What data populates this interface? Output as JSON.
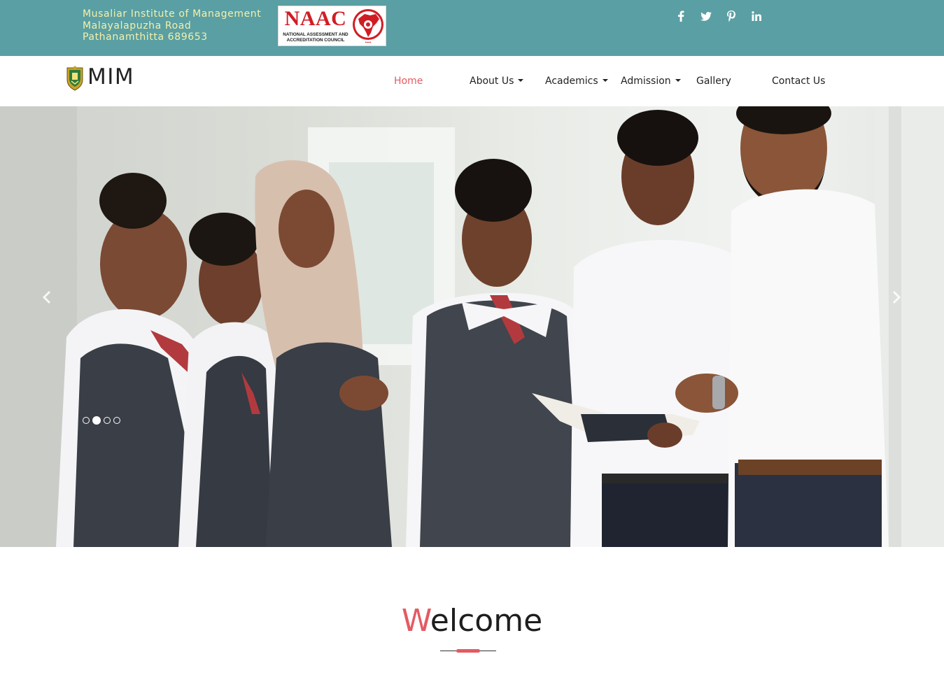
{
  "topbar": {
    "address": [
      "Musaliar Institute of Management",
      "Malayalapuzha Road",
      "Pathanamthitta 689653"
    ],
    "accreditation": {
      "title": "NAAC",
      "subtitle": "NATIONAL ASSESSMENT AND ACCREDITATION COUNCIL"
    },
    "social_icons": [
      "facebook-icon",
      "twitter-icon",
      "pinterest-icon",
      "linkedin-icon"
    ],
    "background_color": "#5a9fa3",
    "text_color": "#f5f1a8"
  },
  "navbar": {
    "logo_text": "MIM",
    "items": [
      {
        "label": "Home",
        "active": true
      },
      {
        "label": "About Us",
        "dropdown": true
      },
      {
        "label": "Academics",
        "dropdown": true
      },
      {
        "label": "Admission",
        "dropdown": true
      },
      {
        "label": "Gallery"
      },
      {
        "label": "Contact Us"
      }
    ],
    "active_color": "#e45a62"
  },
  "carousel": {
    "slide_count": 4,
    "active_slide": 2,
    "controls": [
      "chevron-left-icon",
      "chevron-right-icon"
    ]
  },
  "welcome": {
    "first_letter": "W",
    "rest": "elcome",
    "accent_color": "#e45a62"
  }
}
